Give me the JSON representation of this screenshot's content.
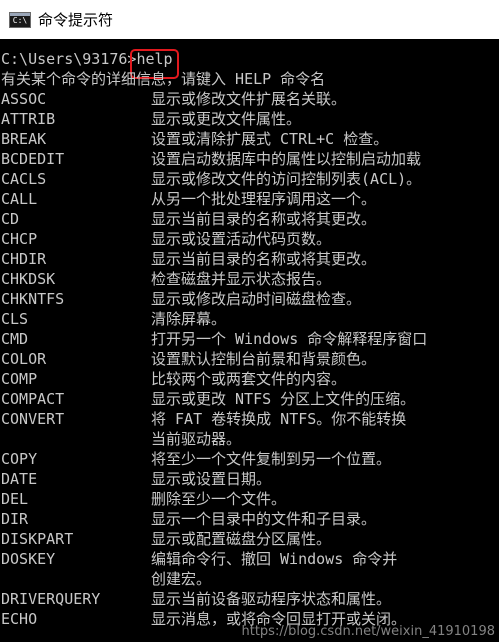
{
  "window": {
    "title": "命令提示符",
    "icon": "cmd-console-icon",
    "icon_label": "C:\\"
  },
  "console": {
    "prompt_path": "C:\\Users\\93176>",
    "prompt_command": "help",
    "intro": "有关某个命令的详细信息，请键入 HELP 命令名",
    "commands": [
      {
        "name": "ASSOC",
        "desc": "显示或修改文件扩展名关联。"
      },
      {
        "name": "ATTRIB",
        "desc": "显示或更改文件属性。"
      },
      {
        "name": "BREAK",
        "desc": "设置或清除扩展式 CTRL+C 检查。"
      },
      {
        "name": "BCDEDIT",
        "desc": "设置启动数据库中的属性以控制启动加载"
      },
      {
        "name": "CACLS",
        "desc": "显示或修改文件的访问控制列表(ACL)。"
      },
      {
        "name": "CALL",
        "desc": "从另一个批处理程序调用这一个。"
      },
      {
        "name": "CD",
        "desc": "显示当前目录的名称或将其更改。"
      },
      {
        "name": "CHCP",
        "desc": "显示或设置活动代码页数。"
      },
      {
        "name": "CHDIR",
        "desc": "显示当前目录的名称或将其更改。"
      },
      {
        "name": "CHKDSK",
        "desc": "检查磁盘并显示状态报告。"
      },
      {
        "name": "CHKNTFS",
        "desc": "显示或修改启动时间磁盘检查。"
      },
      {
        "name": "CLS",
        "desc": "清除屏幕。"
      },
      {
        "name": "CMD",
        "desc": "打开另一个 Windows 命令解释程序窗口"
      },
      {
        "name": "COLOR",
        "desc": "设置默认控制台前景和背景颜色。"
      },
      {
        "name": "COMP",
        "desc": "比较两个或两套文件的内容。"
      },
      {
        "name": "COMPACT",
        "desc": "显示或更改 NTFS 分区上文件的压缩。"
      },
      {
        "name": "CONVERT",
        "desc": "将 FAT 卷转换成 NTFS。你不能转换",
        "desc2": "当前驱动器。"
      },
      {
        "name": "COPY",
        "desc": "将至少一个文件复制到另一个位置。"
      },
      {
        "name": "DATE",
        "desc": "显示或设置日期。"
      },
      {
        "name": "DEL",
        "desc": "删除至少一个文件。"
      },
      {
        "name": "DIR",
        "desc": "显示一个目录中的文件和子目录。"
      },
      {
        "name": "DISKPART",
        "desc": "显示或配置磁盘分区属性。"
      },
      {
        "name": "DOSKEY",
        "desc": "编辑命令行、撤回 Windows 命令并",
        "desc2": "创建宏。"
      },
      {
        "name": "DRIVERQUERY",
        "desc": "显示当前设备驱动程序状态和属性。"
      },
      {
        "name": "ECHO",
        "desc": "显示消息，或将命令回显打开或关闭。"
      }
    ]
  },
  "watermark": "https://blog.csdn.net/weixin_41910198",
  "colors": {
    "console_bg": "#000000",
    "console_text": "#c8c8c8",
    "titlebar_bg": "#ffffff",
    "highlight_border": "#e1191e"
  }
}
